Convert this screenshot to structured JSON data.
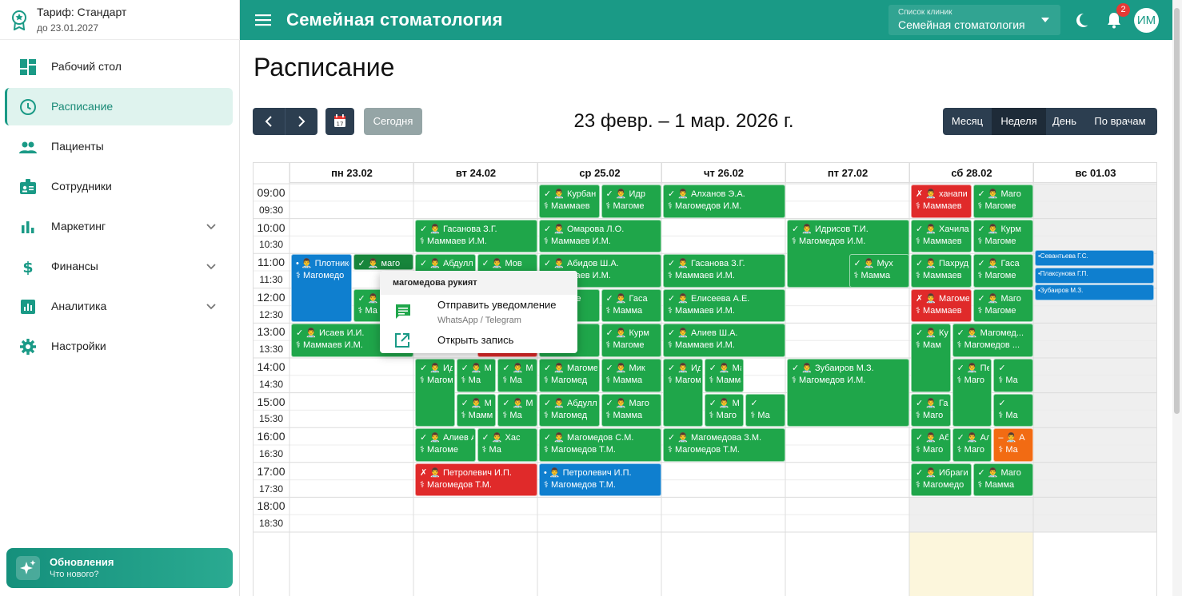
{
  "sidebar": {
    "plan_title": "Тариф: Стандарт",
    "plan_until": "до 23.01.2027",
    "nav": [
      {
        "label": "Рабочий стол",
        "icon": "dashboard-icon"
      },
      {
        "label": "Расписание",
        "icon": "clock-icon",
        "active": true
      },
      {
        "label": "Пациенты",
        "icon": "people-icon"
      },
      {
        "label": "Сотрудники",
        "icon": "badge-icon"
      },
      {
        "label": "Маркетинг",
        "icon": "bar-chart-icon",
        "expandable": true
      },
      {
        "label": "Финансы",
        "icon": "dollar-icon",
        "expandable": true
      },
      {
        "label": "Аналитика",
        "icon": "analytics-icon",
        "expandable": true
      },
      {
        "label": "Настройки",
        "icon": "gear-icon"
      }
    ],
    "updates": {
      "title": "Обновления",
      "subtitle": "Что нового?",
      "icon": "sparkle-icon"
    }
  },
  "topbar": {
    "title": "Семейная стоматология",
    "clinic_label": "Список клиник",
    "clinic_value": "Семейная стоматология",
    "notifications": "2",
    "avatar": "ИМ"
  },
  "schedule": {
    "title": "Расписание",
    "today": "Сегодня",
    "date_range": "23 февр. – 1 мар. 2026 г.",
    "views": [
      "Месяц",
      "Неделя",
      "День",
      "По врачам"
    ],
    "active_view": "Неделя",
    "days": [
      "пн 23.02",
      "вт 24.02",
      "ср 25.02",
      "чт 26.02",
      "пт 27.02",
      "сб 28.02",
      "вс 01.03"
    ],
    "times": [
      "09:00",
      "09:30",
      "10:00",
      "10:30",
      "11:00",
      "11:30",
      "12:00",
      "12:30",
      "13:00",
      "13:30",
      "14:00",
      "14:30",
      "15:00",
      "15:30",
      "16:00",
      "16:30",
      "17:00",
      "17:30",
      "18:00",
      "18:30"
    ]
  },
  "events": [
    {
      "day": 0,
      "start": "11:00",
      "end": "13:00",
      "col": 0,
      "cols": 2,
      "status": "•",
      "color": "blue",
      "patient": "Плотнико",
      "doctor": "Магомедо"
    },
    {
      "day": 0,
      "start": "11:00",
      "end": "11:30",
      "col": 1,
      "cols": 2,
      "status": "✓",
      "color": "dark",
      "patient": "маго",
      "doctor": "Ма"
    },
    {
      "day": 0,
      "start": "12:00",
      "end": "13:00",
      "col": 1,
      "cols": 2,
      "status": "✓",
      "color": "green",
      "patient": "Ма",
      "doctor": "Ма"
    },
    {
      "day": 0,
      "start": "13:00",
      "end": "14:00",
      "col": 0,
      "cols": 1,
      "status": "✓",
      "color": "green",
      "patient": "Исаев И.И.",
      "doctor": "Маммаев И.М."
    },
    {
      "day": 1,
      "start": "10:00",
      "end": "11:00",
      "col": 0,
      "cols": 1,
      "status": "✓",
      "color": "green",
      "patient": "Гасанова З.Г.",
      "doctor": "Маммаев И.М."
    },
    {
      "day": 1,
      "start": "11:00",
      "end": "12:00",
      "col": 0,
      "cols": 2,
      "status": "✓",
      "color": "green",
      "patient": "Абдулл",
      "doctor": "Ма"
    },
    {
      "day": 1,
      "start": "11:00",
      "end": "12:00",
      "col": 1,
      "cols": 2,
      "status": "✓",
      "color": "green",
      "patient": "Мов",
      "doctor": "Ма"
    },
    {
      "day": 1,
      "start": "13:00",
      "end": "14:00",
      "col": 1,
      "cols": 2,
      "status": "",
      "color": "red",
      "patient": "",
      "doctor": ""
    },
    {
      "day": 1,
      "start": "14:00",
      "end": "16:00",
      "col": 0,
      "cols": 3,
      "status": "✓",
      "color": "green",
      "patient": "Ид",
      "doctor": "Магом"
    },
    {
      "day": 1,
      "start": "14:00",
      "end": "15:00",
      "col": 1,
      "cols": 3,
      "status": "✓",
      "color": "green",
      "patient": "М",
      "doctor": "Ма"
    },
    {
      "day": 1,
      "start": "14:00",
      "end": "15:00",
      "col": 2,
      "cols": 3,
      "status": "✓",
      "color": "green",
      "patient": "М",
      "doctor": "Ма"
    },
    {
      "day": 1,
      "start": "15:00",
      "end": "16:00",
      "col": 1,
      "cols": 3,
      "status": "✓",
      "color": "green",
      "patient": "М",
      "doctor": "Мамм"
    },
    {
      "day": 1,
      "start": "15:00",
      "end": "16:00",
      "col": 2,
      "cols": 3,
      "status": "✓",
      "color": "green",
      "patient": "М",
      "doctor": "Ма"
    },
    {
      "day": 1,
      "start": "16:00",
      "end": "17:00",
      "col": 0,
      "cols": 2,
      "status": "✓",
      "color": "green",
      "patient": "Алиев А",
      "doctor": "Магоме"
    },
    {
      "day": 1,
      "start": "16:00",
      "end": "17:00",
      "col": 1,
      "cols": 2,
      "status": "✓",
      "color": "green",
      "patient": "Хас",
      "doctor": "Ма"
    },
    {
      "day": 1,
      "start": "17:00",
      "end": "18:00",
      "col": 0,
      "cols": 1,
      "status": "✗",
      "color": "red",
      "patient": "Петролевич И.П.",
      "doctor": "Магомедов Т.М."
    },
    {
      "day": 2,
      "start": "09:00",
      "end": "10:00",
      "col": 0,
      "cols": 2,
      "status": "✓",
      "color": "green",
      "patient": "Курбан",
      "doctor": "Маммаев"
    },
    {
      "day": 2,
      "start": "09:00",
      "end": "10:00",
      "col": 1,
      "cols": 2,
      "status": "✓",
      "color": "green",
      "patient": "Идр",
      "doctor": "Магоме"
    },
    {
      "day": 2,
      "start": "10:00",
      "end": "11:00",
      "col": 0,
      "cols": 1,
      "status": "✓",
      "color": "green",
      "patient": "Омарова Л.О.",
      "doctor": "Маммаев И.М."
    },
    {
      "day": 2,
      "start": "11:00",
      "end": "12:00",
      "col": 0,
      "cols": 1,
      "status": "✓",
      "color": "green",
      "patient": "Абидов Ш.А.",
      "doctor": "Маммаев И.М."
    },
    {
      "day": 2,
      "start": "12:00",
      "end": "13:00",
      "col": 0,
      "cols": 2,
      "status": "",
      "color": "green",
      "patient": "агоме",
      "doctor": "Ма"
    },
    {
      "day": 2,
      "start": "12:00",
      "end": "13:00",
      "col": 1,
      "cols": 2,
      "status": "✓",
      "color": "green",
      "patient": "Гаса",
      "doctor": "Мамма"
    },
    {
      "day": 2,
      "start": "13:00",
      "end": "14:00",
      "col": 0,
      "cols": 2,
      "status": "",
      "color": "green",
      "patient": "ев И",
      "doctor": "Ма"
    },
    {
      "day": 2,
      "start": "13:00",
      "end": "14:00",
      "col": 1,
      "cols": 2,
      "status": "✓",
      "color": "green",
      "patient": "Курм",
      "doctor": "Магоме"
    },
    {
      "day": 2,
      "start": "14:00",
      "end": "15:00",
      "col": 0,
      "cols": 2,
      "status": "✓",
      "color": "green",
      "patient": "Магоме",
      "doctor": "Магомед"
    },
    {
      "day": 2,
      "start": "14:00",
      "end": "15:00",
      "col": 1,
      "cols": 2,
      "status": "✓",
      "color": "green",
      "patient": "Мик",
      "doctor": "Мамма"
    },
    {
      "day": 2,
      "start": "15:00",
      "end": "16:00",
      "col": 0,
      "cols": 2,
      "status": "✓",
      "color": "green",
      "patient": "Абдулл",
      "doctor": "Магомед"
    },
    {
      "day": 2,
      "start": "15:00",
      "end": "16:00",
      "col": 1,
      "cols": 2,
      "status": "✓",
      "color": "green",
      "patient": "Маго",
      "doctor": "Мамма"
    },
    {
      "day": 2,
      "start": "16:00",
      "end": "17:00",
      "col": 0,
      "cols": 1,
      "status": "✓",
      "color": "green",
      "patient": "Магомедов С.М.",
      "doctor": "Магомедов Т.М."
    },
    {
      "day": 2,
      "start": "17:00",
      "end": "18:00",
      "col": 0,
      "cols": 1,
      "status": "•",
      "color": "blue",
      "patient": "Петролевич И.П.",
      "doctor": "Магомедов Т.М."
    },
    {
      "day": 3,
      "start": "09:00",
      "end": "10:00",
      "col": 0,
      "cols": 1,
      "status": "✓",
      "color": "green",
      "patient": "Алханов Э.А.",
      "doctor": "Магомедов И.М."
    },
    {
      "day": 3,
      "start": "11:00",
      "end": "12:00",
      "col": 0,
      "cols": 1,
      "status": "✓",
      "color": "green",
      "patient": "Гасанова З.Г.",
      "doctor": "Маммаев И.М."
    },
    {
      "day": 3,
      "start": "12:00",
      "end": "13:00",
      "col": 0,
      "cols": 1,
      "status": "✓",
      "color": "green",
      "patient": "Елисеева А.Е.",
      "doctor": "Маммаев И.М."
    },
    {
      "day": 3,
      "start": "13:00",
      "end": "14:00",
      "col": 0,
      "cols": 1,
      "status": "✓",
      "color": "green",
      "patient": "Алиев Ш.А.",
      "doctor": "Маммаев И.М."
    },
    {
      "day": 3,
      "start": "14:00",
      "end": "16:00",
      "col": 0,
      "cols": 3,
      "status": "✓",
      "color": "green",
      "patient": "Ид",
      "doctor": "Магом"
    },
    {
      "day": 3,
      "start": "14:00",
      "end": "15:00",
      "col": 1,
      "cols": 3,
      "status": "✓",
      "color": "green",
      "patient": "Магомае",
      "doctor": "Маммаев И..."
    },
    {
      "day": 3,
      "start": "15:00",
      "end": "16:00",
      "col": 1,
      "cols": 3,
      "status": "✓",
      "color": "green",
      "patient": "М",
      "doctor": "Маго"
    },
    {
      "day": 3,
      "start": "15:00",
      "end": "16:00",
      "col": 2,
      "cols": 3,
      "status": "✓",
      "color": "green",
      "patient": "",
      "doctor": "Ма"
    },
    {
      "day": 3,
      "start": "16:00",
      "end": "17:00",
      "col": 0,
      "cols": 1,
      "status": "✓",
      "color": "green",
      "patient": "Магомедова З.М.",
      "doctor": "Магомедов Т.М."
    },
    {
      "day": 4,
      "start": "10:00",
      "end": "12:00",
      "col": 0,
      "cols": 1,
      "status": "✓",
      "color": "green",
      "patient": "Идрисов Т.И.",
      "doctor": "Магомедов И.М."
    },
    {
      "day": 4,
      "start": "11:00",
      "end": "12:00",
      "col": 1,
      "cols": 2,
      "status": "✓",
      "color": "green",
      "patient": "Мух",
      "doctor": "Мамма"
    },
    {
      "day": 4,
      "start": "14:00",
      "end": "16:00",
      "col": 0,
      "cols": 1,
      "status": "✓",
      "color": "green",
      "patient": "Зубаиров М.З.",
      "doctor": "Магомедов И.М."
    },
    {
      "day": 5,
      "start": "09:00",
      "end": "10:00",
      "col": 0,
      "cols": 2,
      "status": "✗",
      "color": "red",
      "patient": "ханапи",
      "doctor": "Маммаев"
    },
    {
      "day": 5,
      "start": "09:00",
      "end": "10:00",
      "col": 1,
      "cols": 2,
      "status": "✓",
      "color": "green",
      "patient": "Маго",
      "doctor": "Магоме"
    },
    {
      "day": 5,
      "start": "10:00",
      "end": "11:00",
      "col": 0,
      "cols": 2,
      "status": "✓",
      "color": "green",
      "patient": "Хачила",
      "doctor": "Маммаев"
    },
    {
      "day": 5,
      "start": "10:00",
      "end": "11:00",
      "col": 1,
      "cols": 2,
      "status": "✓",
      "color": "green",
      "patient": "Курм",
      "doctor": "Магоме"
    },
    {
      "day": 5,
      "start": "11:00",
      "end": "12:00",
      "col": 0,
      "cols": 2,
      "status": "✓",
      "color": "green",
      "patient": "Пахруд",
      "doctor": "Маммаев"
    },
    {
      "day": 5,
      "start": "11:00",
      "end": "12:00",
      "col": 1,
      "cols": 2,
      "status": "✓",
      "color": "green",
      "patient": "Гаса",
      "doctor": "Магоме"
    },
    {
      "day": 5,
      "start": "12:00",
      "end": "13:00",
      "col": 0,
      "cols": 2,
      "status": "✗",
      "color": "red",
      "patient": "Магоме",
      "doctor": "Маммаев"
    },
    {
      "day": 5,
      "start": "12:00",
      "end": "13:00",
      "col": 1,
      "cols": 2,
      "status": "✓",
      "color": "green",
      "patient": "Маго",
      "doctor": "Магоме"
    },
    {
      "day": 5,
      "start": "13:00",
      "end": "15:00",
      "col": 0,
      "cols": 3,
      "status": "✓",
      "color": "green",
      "patient": "Ку",
      "doctor": "Мам"
    },
    {
      "day": 5,
      "start": "13:00",
      "end": "14:00",
      "col": 1,
      "cols": 3,
      "span": 2,
      "status": "✓",
      "color": "green",
      "patient": "Магомед...",
      "doctor": "Магомедов ..."
    },
    {
      "day": 5,
      "start": "14:00",
      "end": "16:00",
      "col": 1,
      "cols": 3,
      "status": "✓",
      "color": "green",
      "patient": "Пе",
      "doctor": "Маго"
    },
    {
      "day": 5,
      "start": "14:00",
      "end": "15:00",
      "col": 2,
      "cols": 3,
      "status": "✓",
      "color": "green",
      "patient": "",
      "doctor": "Ма"
    },
    {
      "day": 5,
      "start": "15:00",
      "end": "16:00",
      "col": 0,
      "cols": 3,
      "status": "✓",
      "color": "green",
      "patient": "Гас",
      "doctor": "Маго"
    },
    {
      "day": 5,
      "start": "15:00",
      "end": "16:00",
      "col": 2,
      "cols": 3,
      "status": "✓",
      "color": "green",
      "patient": "",
      "doctor": "Ма"
    },
    {
      "day": 5,
      "start": "16:00",
      "end": "17:00",
      "col": 0,
      "cols": 3,
      "status": "✓",
      "color": "green",
      "patient": "Аб",
      "doctor": "Маго"
    },
    {
      "day": 5,
      "start": "16:00",
      "end": "17:00",
      "col": 1,
      "cols": 3,
      "status": "✓",
      "color": "green",
      "patient": "Ал",
      "doctor": "Маго"
    },
    {
      "day": 5,
      "start": "16:00",
      "end": "17:00",
      "col": 2,
      "cols": 3,
      "status": "–",
      "color": "orange",
      "patient": "А",
      "doctor": "Ма"
    },
    {
      "day": 5,
      "start": "17:00",
      "end": "18:00",
      "col": 0,
      "cols": 2,
      "status": "✓",
      "color": "green",
      "patient": "Ибраги",
      "doctor": "Магомедо"
    },
    {
      "day": 5,
      "start": "17:00",
      "end": "18:00",
      "col": 1,
      "cols": 2,
      "status": "✓",
      "color": "green",
      "patient": "Маго",
      "doctor": "Мамма"
    }
  ],
  "sunday_events": [
    {
      "status": "•",
      "patient": "Севантьева Г.С."
    },
    {
      "status": "•",
      "patient": "Плаксунова Г.П."
    },
    {
      "status": "•",
      "patient": "Зубаиров М.З."
    }
  ],
  "popup": {
    "title": "магомедова рукият",
    "notify_label": "Отправить уведомление",
    "notify_sub": "WhatsApp / Telegram",
    "open_label": "Открыть запись"
  },
  "colors": {
    "primary": "#1a9a86",
    "confirmed": "#1fa64a",
    "cancelled": "#e02a2a",
    "scheduled": "#0f7fcf",
    "pending": "#f26b13"
  }
}
